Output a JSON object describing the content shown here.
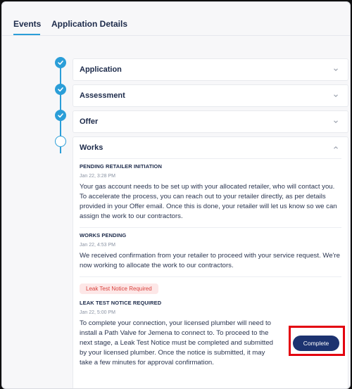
{
  "tabs": [
    {
      "label": "Events",
      "active": true
    },
    {
      "label": "Application Details",
      "active": false
    }
  ],
  "steps": [
    {
      "title": "Application",
      "status": "completed",
      "icon": "chevron-down-icon"
    },
    {
      "title": "Assessment",
      "status": "completed",
      "icon": "chevron-down-icon"
    },
    {
      "title": "Offer",
      "status": "completed",
      "icon": "chevron-down-icon"
    },
    {
      "title": "Works",
      "status": "current",
      "icon": "chevron-up-icon"
    }
  ],
  "works": {
    "events": [
      {
        "title": "PENDING RETAILER INITIATION",
        "date": "Jan 22, 3:28 PM",
        "text": "Your gas account needs to be set up with your allocated retailer, who will contact you. To accelerate the process, you can reach out to your retailer directly, as per details provided in your Offer email. Once this is done, your retailer will let us know so we can assign the work to our contractors."
      },
      {
        "title": "WORKS PENDING",
        "date": "Jan 22, 4:53 PM",
        "text": "We received confirmation from your retailer to proceed with your service request. We're now working to allocate the work to our contractors."
      },
      {
        "badge": "Leak Test Notice Required",
        "title": "LEAK TEST NOTICE REQUIRED",
        "date": "Jan 22, 5:00 PM",
        "text": "To complete your connection, your licensed plumber will need to install a Path Valve for Jemena to connect to. To proceed to the next stage, a Leak Test Notice must be completed and submitted by your licensed plumber. Once the notice is submitted, it may take a few minutes for approval confirmation.",
        "action_label": "Complete"
      }
    ]
  },
  "colors": {
    "accent": "#2b9ed8",
    "button": "#1c3370",
    "badge_bg": "#fde7e7",
    "badge_text": "#d9413c",
    "highlight": "#e3000f"
  }
}
